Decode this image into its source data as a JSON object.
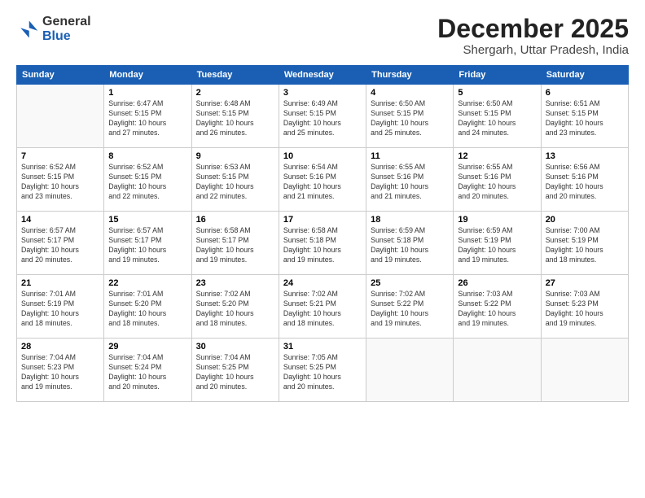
{
  "logo": {
    "general": "General",
    "blue": "Blue"
  },
  "header": {
    "month": "December 2025",
    "location": "Shergarh, Uttar Pradesh, India"
  },
  "weekdays": [
    "Sunday",
    "Monday",
    "Tuesday",
    "Wednesday",
    "Thursday",
    "Friday",
    "Saturday"
  ],
  "weeks": [
    [
      {
        "day": "",
        "info": ""
      },
      {
        "day": "1",
        "info": "Sunrise: 6:47 AM\nSunset: 5:15 PM\nDaylight: 10 hours\nand 27 minutes."
      },
      {
        "day": "2",
        "info": "Sunrise: 6:48 AM\nSunset: 5:15 PM\nDaylight: 10 hours\nand 26 minutes."
      },
      {
        "day": "3",
        "info": "Sunrise: 6:49 AM\nSunset: 5:15 PM\nDaylight: 10 hours\nand 25 minutes."
      },
      {
        "day": "4",
        "info": "Sunrise: 6:50 AM\nSunset: 5:15 PM\nDaylight: 10 hours\nand 25 minutes."
      },
      {
        "day": "5",
        "info": "Sunrise: 6:50 AM\nSunset: 5:15 PM\nDaylight: 10 hours\nand 24 minutes."
      },
      {
        "day": "6",
        "info": "Sunrise: 6:51 AM\nSunset: 5:15 PM\nDaylight: 10 hours\nand 23 minutes."
      }
    ],
    [
      {
        "day": "7",
        "info": "Sunrise: 6:52 AM\nSunset: 5:15 PM\nDaylight: 10 hours\nand 23 minutes."
      },
      {
        "day": "8",
        "info": "Sunrise: 6:52 AM\nSunset: 5:15 PM\nDaylight: 10 hours\nand 22 minutes."
      },
      {
        "day": "9",
        "info": "Sunrise: 6:53 AM\nSunset: 5:15 PM\nDaylight: 10 hours\nand 22 minutes."
      },
      {
        "day": "10",
        "info": "Sunrise: 6:54 AM\nSunset: 5:16 PM\nDaylight: 10 hours\nand 21 minutes."
      },
      {
        "day": "11",
        "info": "Sunrise: 6:55 AM\nSunset: 5:16 PM\nDaylight: 10 hours\nand 21 minutes."
      },
      {
        "day": "12",
        "info": "Sunrise: 6:55 AM\nSunset: 5:16 PM\nDaylight: 10 hours\nand 20 minutes."
      },
      {
        "day": "13",
        "info": "Sunrise: 6:56 AM\nSunset: 5:16 PM\nDaylight: 10 hours\nand 20 minutes."
      }
    ],
    [
      {
        "day": "14",
        "info": "Sunrise: 6:57 AM\nSunset: 5:17 PM\nDaylight: 10 hours\nand 20 minutes."
      },
      {
        "day": "15",
        "info": "Sunrise: 6:57 AM\nSunset: 5:17 PM\nDaylight: 10 hours\nand 19 minutes."
      },
      {
        "day": "16",
        "info": "Sunrise: 6:58 AM\nSunset: 5:17 PM\nDaylight: 10 hours\nand 19 minutes."
      },
      {
        "day": "17",
        "info": "Sunrise: 6:58 AM\nSunset: 5:18 PM\nDaylight: 10 hours\nand 19 minutes."
      },
      {
        "day": "18",
        "info": "Sunrise: 6:59 AM\nSunset: 5:18 PM\nDaylight: 10 hours\nand 19 minutes."
      },
      {
        "day": "19",
        "info": "Sunrise: 6:59 AM\nSunset: 5:19 PM\nDaylight: 10 hours\nand 19 minutes."
      },
      {
        "day": "20",
        "info": "Sunrise: 7:00 AM\nSunset: 5:19 PM\nDaylight: 10 hours\nand 18 minutes."
      }
    ],
    [
      {
        "day": "21",
        "info": "Sunrise: 7:01 AM\nSunset: 5:19 PM\nDaylight: 10 hours\nand 18 minutes."
      },
      {
        "day": "22",
        "info": "Sunrise: 7:01 AM\nSunset: 5:20 PM\nDaylight: 10 hours\nand 18 minutes."
      },
      {
        "day": "23",
        "info": "Sunrise: 7:02 AM\nSunset: 5:20 PM\nDaylight: 10 hours\nand 18 minutes."
      },
      {
        "day": "24",
        "info": "Sunrise: 7:02 AM\nSunset: 5:21 PM\nDaylight: 10 hours\nand 18 minutes."
      },
      {
        "day": "25",
        "info": "Sunrise: 7:02 AM\nSunset: 5:22 PM\nDaylight: 10 hours\nand 19 minutes."
      },
      {
        "day": "26",
        "info": "Sunrise: 7:03 AM\nSunset: 5:22 PM\nDaylight: 10 hours\nand 19 minutes."
      },
      {
        "day": "27",
        "info": "Sunrise: 7:03 AM\nSunset: 5:23 PM\nDaylight: 10 hours\nand 19 minutes."
      }
    ],
    [
      {
        "day": "28",
        "info": "Sunrise: 7:04 AM\nSunset: 5:23 PM\nDaylight: 10 hours\nand 19 minutes."
      },
      {
        "day": "29",
        "info": "Sunrise: 7:04 AM\nSunset: 5:24 PM\nDaylight: 10 hours\nand 20 minutes."
      },
      {
        "day": "30",
        "info": "Sunrise: 7:04 AM\nSunset: 5:25 PM\nDaylight: 10 hours\nand 20 minutes."
      },
      {
        "day": "31",
        "info": "Sunrise: 7:05 AM\nSunset: 5:25 PM\nDaylight: 10 hours\nand 20 minutes."
      },
      {
        "day": "",
        "info": ""
      },
      {
        "day": "",
        "info": ""
      },
      {
        "day": "",
        "info": ""
      }
    ]
  ]
}
